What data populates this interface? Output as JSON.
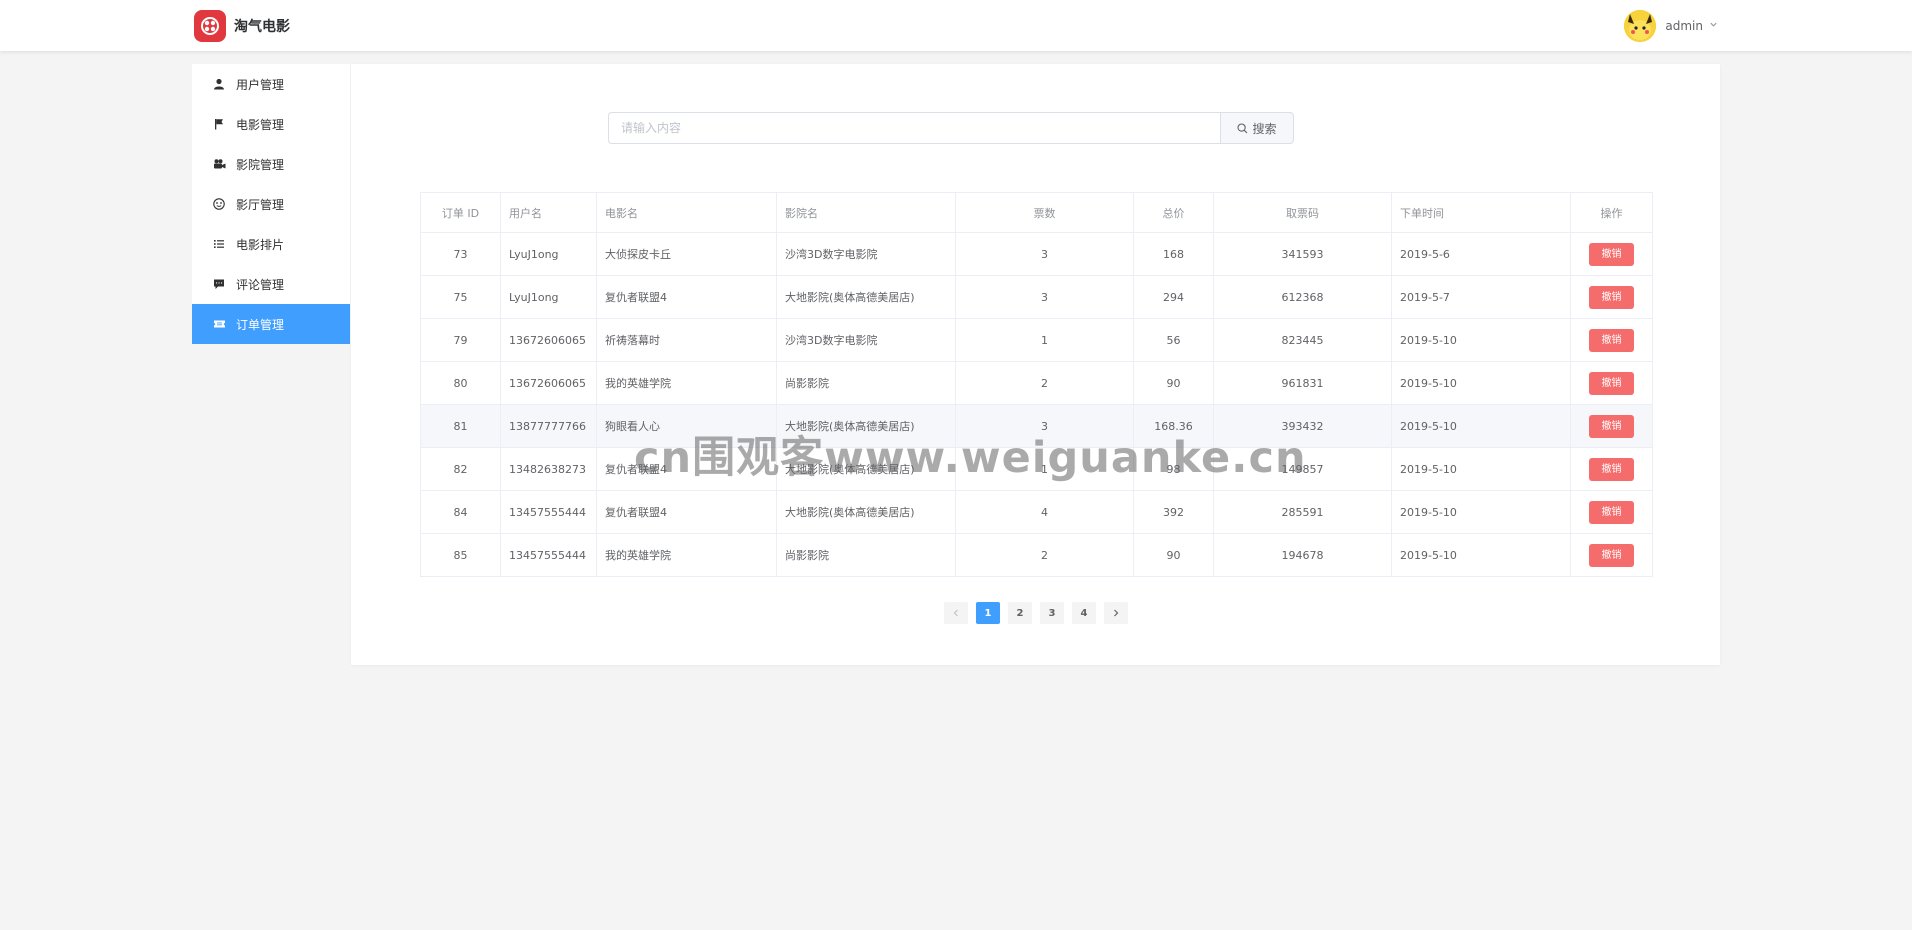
{
  "header": {
    "brand": "淘气电影",
    "username": "admin",
    "logo_color": "#e0383e"
  },
  "sidebar": {
    "items": [
      {
        "label": "用户管理",
        "icon": "user-icon"
      },
      {
        "label": "电影管理",
        "icon": "flag-icon"
      },
      {
        "label": "影院管理",
        "icon": "camera-icon"
      },
      {
        "label": "影厅管理",
        "icon": "film-reel-icon"
      },
      {
        "label": "电影排片",
        "icon": "list-icon"
      },
      {
        "label": "评论管理",
        "icon": "comment-icon"
      },
      {
        "label": "订单管理",
        "icon": "ticket-icon",
        "active": true
      }
    ],
    "accent": "#409eff"
  },
  "search": {
    "placeholder": "请输入内容",
    "button_label": "搜索"
  },
  "table": {
    "columns": [
      "订单 ID",
      "用户名",
      "电影名",
      "影院名",
      "票数",
      "总价",
      "取票码",
      "下单时间",
      "操作"
    ],
    "action_label": "撤销",
    "action_color": "#f56c6c",
    "rows": [
      {
        "id": "73",
        "user": "LyuJ1ong",
        "movie": "大侦探皮卡丘",
        "cinema": "沙湾3D数字电影院",
        "tickets": "3",
        "total": "168",
        "code": "341593",
        "time": "2019-5-6"
      },
      {
        "id": "75",
        "user": "LyuJ1ong",
        "movie": "复仇者联盟4",
        "cinema": "大地影院(奥体高德美居店)",
        "tickets": "3",
        "total": "294",
        "code": "612368",
        "time": "2019-5-7"
      },
      {
        "id": "79",
        "user": "13672606065",
        "movie": "祈祷落幕时",
        "cinema": "沙湾3D数字电影院",
        "tickets": "1",
        "total": "56",
        "code": "823445",
        "time": "2019-5-10"
      },
      {
        "id": "80",
        "user": "13672606065",
        "movie": "我的英雄学院",
        "cinema": "尚影影院",
        "tickets": "2",
        "total": "90",
        "code": "961831",
        "time": "2019-5-10"
      },
      {
        "id": "81",
        "user": "13877777766",
        "movie": "狗眼看人心",
        "cinema": "大地影院(奥体高德美居店)",
        "tickets": "3",
        "total": "168.36",
        "code": "393432",
        "time": "2019-5-10"
      },
      {
        "id": "82",
        "user": "13482638273",
        "movie": "复仇者联盟4",
        "cinema": "大地影院(奥体高德美居店)",
        "tickets": "1",
        "total": "98",
        "code": "149857",
        "time": "2019-5-10"
      },
      {
        "id": "84",
        "user": "13457555444",
        "movie": "复仇者联盟4",
        "cinema": "大地影院(奥体高德美居店)",
        "tickets": "4",
        "total": "392",
        "code": "285591",
        "time": "2019-5-10"
      },
      {
        "id": "85",
        "user": "13457555444",
        "movie": "我的英雄学院",
        "cinema": "尚影影院",
        "tickets": "2",
        "total": "90",
        "code": "194678",
        "time": "2019-5-10"
      }
    ]
  },
  "pagination": {
    "pages": [
      "1",
      "2",
      "3",
      "4"
    ],
    "current": "1"
  },
  "watermark": "cn围观客www.weiguanke.cn"
}
